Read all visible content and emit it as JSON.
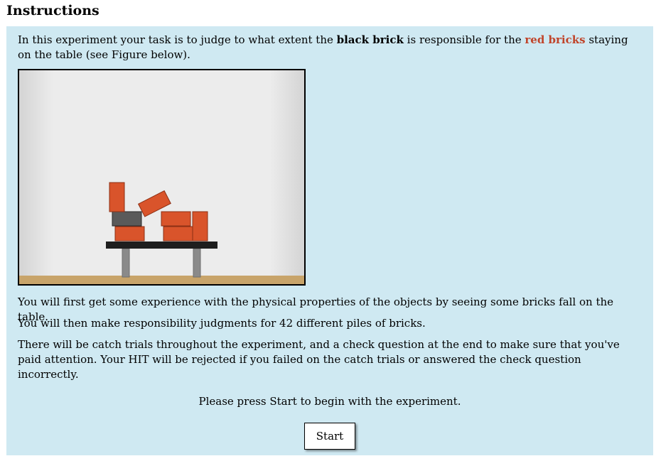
{
  "heading": "Instructions",
  "intro": {
    "part1": "In this experiment your task is to judge to what extent the ",
    "black_brick": "black brick",
    "part2": " is responsible for the ",
    "red_bricks": "red bricks",
    "part3": " staying on the table (see Figure below)."
  },
  "paragraphs": [
    "You will first get some experience with the physical properties of the objects by seeing some bricks fall on the table.",
    "You will then make responsibility judgments for 42 different piles of bricks.",
    "There will be catch trials throughout the experiment, and a check question at the end to make sure that you've paid attention. Your HIT will be rejected if you failed on the catch trials or answered the check question incorrectly."
  ],
  "prompt": "Please press Start to begin with the experiment.",
  "start_button": "Start",
  "colors": {
    "panel_bg": "#cfe9f2",
    "red_text": "#c0442a",
    "brick_red": "#d9542b",
    "brick_black": "#555555",
    "table_top": "#1e1e1e",
    "table_leg": "#8a8a8a",
    "floor": "#c8a46a"
  }
}
